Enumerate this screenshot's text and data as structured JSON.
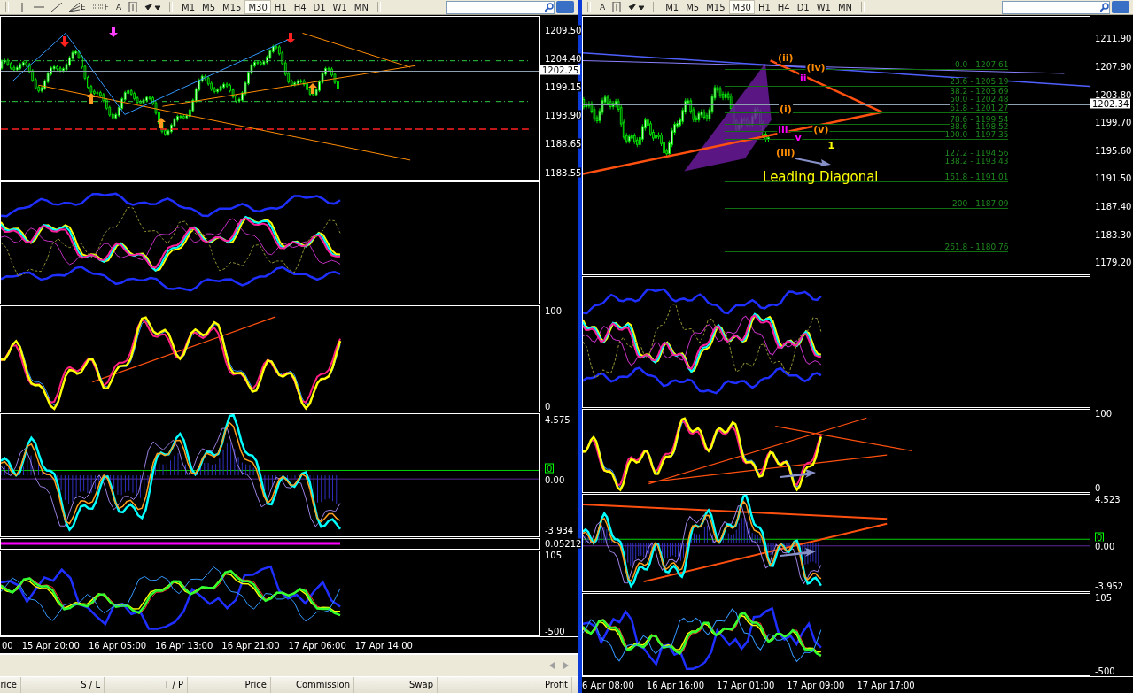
{
  "windows": [
    {
      "toolbar": {
        "tools": [
          {
            "kind": "vline"
          },
          {
            "kind": "hline"
          },
          {
            "kind": "trendline"
          },
          {
            "kind": "fan",
            "label": "E"
          },
          {
            "kind": "channel",
            "label": "F"
          },
          {
            "kind": "text",
            "label": "A"
          },
          {
            "kind": "textlabel"
          },
          {
            "kind": "arrows"
          }
        ],
        "timeframes": [
          {
            "label": "M1",
            "selected": false
          },
          {
            "label": "M5",
            "selected": false
          },
          {
            "label": "M15",
            "selected": false
          },
          {
            "label": "M30",
            "selected": true
          },
          {
            "label": "H1",
            "selected": false
          },
          {
            "label": "H4",
            "selected": false
          },
          {
            "label": "D1",
            "selected": false
          },
          {
            "label": "W1",
            "selected": false
          },
          {
            "label": "MN",
            "selected": false
          }
        ]
      },
      "chart": {
        "panes": [
          {
            "kind": "price",
            "axis_labels": [
              "1209.50",
              "1204.40",
              "1199.15",
              "1193.90",
              "1188.65",
              "1183.55"
            ],
            "current_price": "1202.25"
          },
          {
            "kind": "bands"
          },
          {
            "kind": "oscillator",
            "axis_labels": [
              "100",
              "0"
            ]
          },
          {
            "kind": "macd",
            "axis_labels": [
              "4.575",
              "0",
              "0.00",
              "-3.934"
            ]
          },
          {
            "kind": "thin",
            "axis_labels": [
              "0.05212"
            ]
          },
          {
            "kind": "volume",
            "axis_labels": [
              "105",
              "-500"
            ]
          }
        ],
        "time_axis": [
          "00",
          "15 Apr 20:00",
          "16 Apr 05:00",
          "16 Apr 13:00",
          "16 Apr 21:00",
          "17 Apr 06:00",
          "17 Apr 14:00"
        ]
      },
      "terminal": {
        "columns": [
          "rice",
          "S / L",
          "T / P",
          "Price",
          "Commission",
          "Swap",
          "Profit"
        ]
      }
    },
    {
      "toolbar": {
        "tools": [
          {
            "kind": "text",
            "label": "A"
          },
          {
            "kind": "textlabel"
          },
          {
            "kind": "arrows"
          }
        ],
        "timeframes": [
          {
            "label": "M1",
            "selected": false
          },
          {
            "label": "M5",
            "selected": false
          },
          {
            "label": "M15",
            "selected": false
          },
          {
            "label": "M30",
            "selected": true
          },
          {
            "label": "H1",
            "selected": false
          },
          {
            "label": "H4",
            "selected": false
          },
          {
            "label": "D1",
            "selected": false
          },
          {
            "label": "W1",
            "selected": false
          },
          {
            "label": "MN",
            "selected": false
          }
        ]
      },
      "chart": {
        "panes": [
          {
            "kind": "price",
            "axis_labels": [
              "1211.90",
              "1207.90",
              "1203.80",
              "1199.70",
              "1195.60",
              "1191.50",
              "1187.40",
              "1183.30",
              "1179.20"
            ],
            "current_price": "1202.34",
            "fibonacci_levels": [
              "0.0 - 1207.61",
              "23.6 - 1205.19",
              "38.2 - 1203.69",
              "50.0 - 1202.48",
              "61.8 - 1201.27",
              "78.6 - 1199.54",
              "88.6 - 1198.52",
              "100.0 - 1197.35",
              "127.2 - 1194.56",
              "138.2 - 1193.43",
              "161.8 - 1191.01",
              "200 - 1187.09",
              "261.8 - 1180.76"
            ],
            "annotation": "Leading Diagonal",
            "wave_labels": [
              {
                "text": "(ii)",
                "color": "#ff8c00"
              },
              {
                "text": "(iv)",
                "color": "#ff8c00"
              },
              {
                "text": "(i)",
                "color": "#ff8c00"
              },
              {
                "text": "(iii)",
                "color": "#ff8c00"
              },
              {
                "text": "(v)",
                "color": "#ff8c00"
              },
              {
                "text": "1",
                "color": "#ffff00"
              },
              {
                "text": "ii",
                "color": "#ff00ff"
              },
              {
                "text": "iii",
                "color": "#ff00ff"
              },
              {
                "text": "v",
                "color": "#ff00ff"
              }
            ]
          },
          {
            "kind": "bands"
          },
          {
            "kind": "oscillator",
            "axis_labels": [
              "100",
              "0"
            ]
          },
          {
            "kind": "macd",
            "axis_labels": [
              "4.523",
              "0",
              "0.00",
              "-3.952"
            ]
          },
          {
            "kind": "volume",
            "axis_labels": [
              "105",
              "-500"
            ]
          }
        ],
        "time_axis": [
          "6 Apr 08:00",
          "16 Apr 16:00",
          "17 Apr 01:00",
          "17 Apr 09:00",
          "17 Apr 17:00"
        ]
      }
    }
  ]
}
